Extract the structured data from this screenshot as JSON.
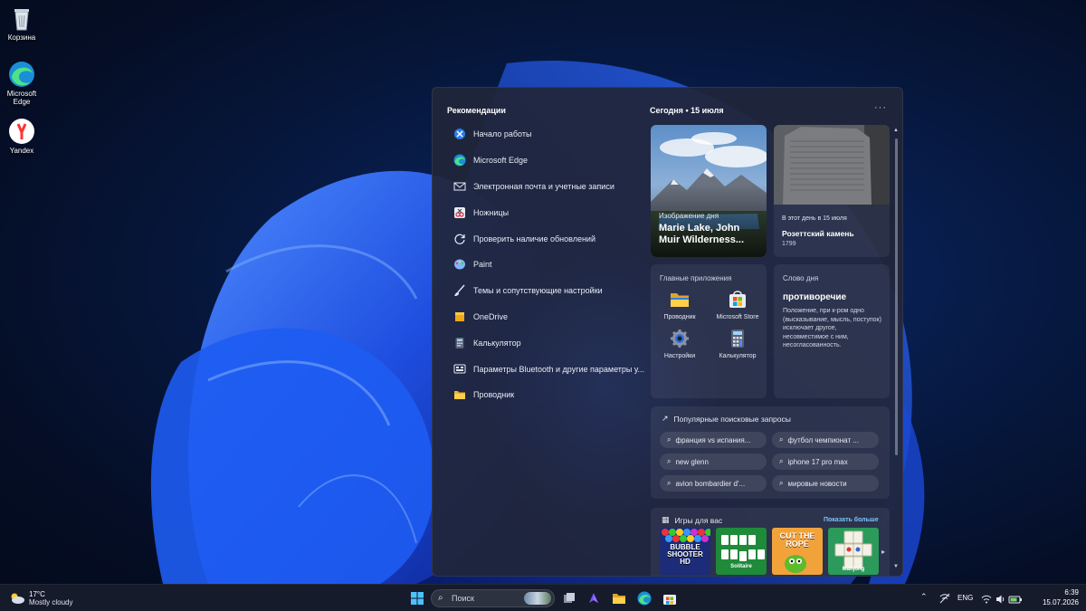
{
  "desktop": {
    "icons": [
      {
        "label": "Корзина",
        "icon": "recycle-bin-icon"
      },
      {
        "label": "Microsoft Edge",
        "icon": "edge-icon"
      },
      {
        "label": "Yandex",
        "icon": "yandex-icon"
      }
    ]
  },
  "panel": {
    "recommendations_title": "Рекомендации",
    "recommendations": [
      {
        "label": "Начало работы",
        "icon": "get-started-icon"
      },
      {
        "label": "Microsoft Edge",
        "icon": "edge-icon"
      },
      {
        "label": "Электронная почта и учетные записи",
        "icon": "mail-icon"
      },
      {
        "label": "Ножницы",
        "icon": "snipping-tool-icon"
      },
      {
        "label": "Проверить наличие обновлений",
        "icon": "refresh-icon"
      },
      {
        "label": "Paint",
        "icon": "paint-icon"
      },
      {
        "label": "Темы и сопутствующие настройки",
        "icon": "brush-icon"
      },
      {
        "label": "OneDrive",
        "icon": "onedrive-icon"
      },
      {
        "label": "Калькулятор",
        "icon": "calculator-icon"
      },
      {
        "label": "Параметры Bluetooth и другие параметры у...",
        "icon": "bluetooth-settings-icon"
      },
      {
        "label": "Проводник",
        "icon": "folder-icon"
      }
    ],
    "today_label": "Сегодня",
    "today_date": "15 июля",
    "photo_card": {
      "kicker": "Изображение дня",
      "title": "Marie Lake, John Muir Wilderness..."
    },
    "history_card": {
      "kicker": "В этот день в 15 июля",
      "title": "Розеттский камень",
      "year": "1799"
    },
    "apps_card": {
      "title": "Главные приложения",
      "apps": [
        {
          "label": "Проводник",
          "icon": "folder-icon"
        },
        {
          "label": "Microsoft Store",
          "icon": "store-icon"
        },
        {
          "label": "Настройки",
          "icon": "gear-icon"
        },
        {
          "label": "Калькулятор",
          "icon": "calculator-icon"
        }
      ]
    },
    "word_card": {
      "title": "Слово дня",
      "word": "противоречие",
      "definition": "Положение, при к-ром одно (высказывание, мысль, поступок) исключает другое, несовместимое с ним, несогласованность."
    },
    "search_card": {
      "title": "Популярные поисковые запросы",
      "queries": [
        "франция vs испания...",
        "футбол чемпионат ...",
        "new glenn",
        "iphone 17 pro max",
        "avion bombardier d'...",
        "мировые новости"
      ]
    },
    "games_card": {
      "title": "Игры для вас",
      "show_more": "Показать больше",
      "games": [
        {
          "name": "BUBBLE SHOOTER HD"
        },
        {
          "name": "Solitaire"
        },
        {
          "name": "CUT THE ROPE"
        },
        {
          "name": "Mahjong"
        }
      ]
    }
  },
  "taskbar": {
    "weather_temp": "17°C",
    "weather_text": "Mostly cloudy",
    "search_placeholder": "Поиск",
    "language": "ENG",
    "time": "6:39",
    "date": "15.07.2026"
  },
  "colors": {
    "accent": "#1a6fe8",
    "panel": "#20263a",
    "link": "#7cc4ff"
  }
}
